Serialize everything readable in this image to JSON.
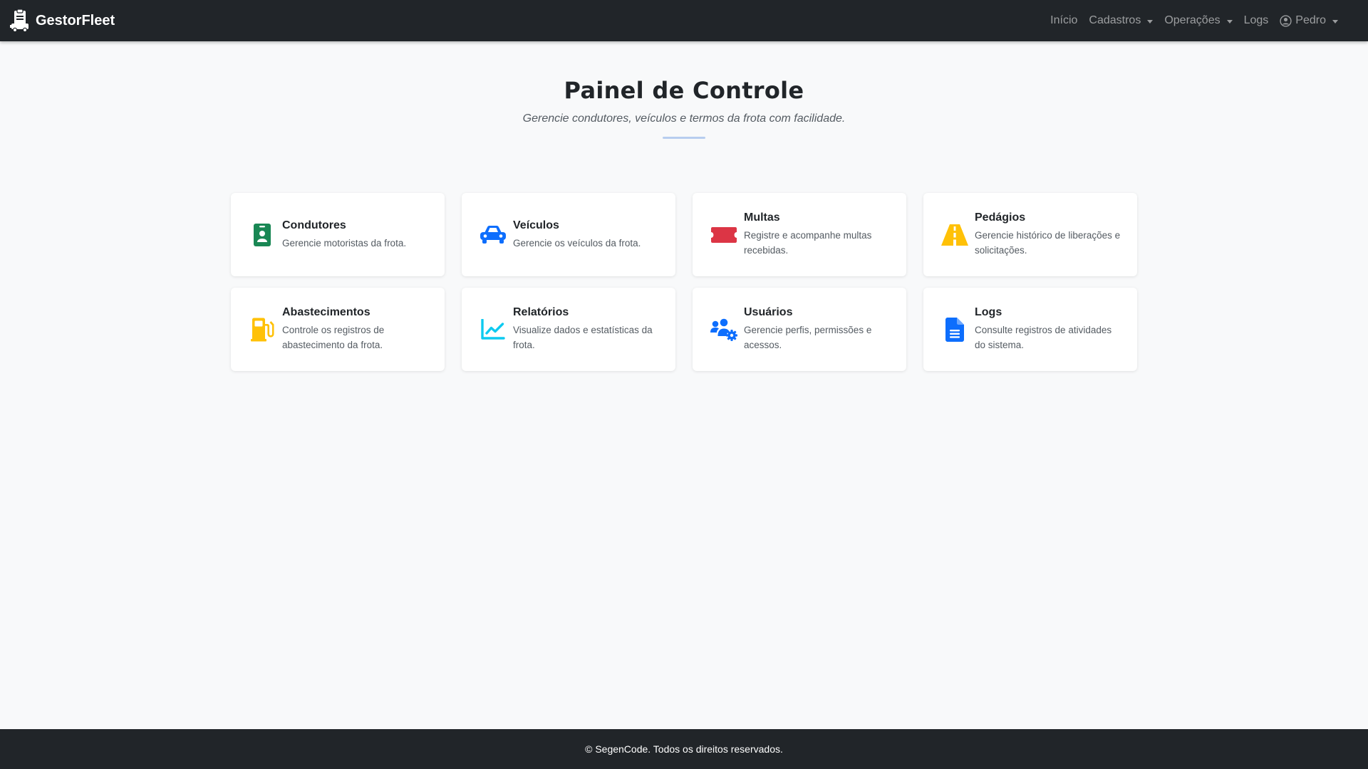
{
  "brand": {
    "name": "GestorFleet",
    "icon": "truck-clipboard-icon"
  },
  "nav": {
    "items": [
      {
        "label": "Início",
        "dropdown": false
      },
      {
        "label": "Cadastros",
        "dropdown": true
      },
      {
        "label": "Operações",
        "dropdown": true
      },
      {
        "label": "Logs",
        "dropdown": false
      }
    ],
    "user": {
      "label": "Pedro",
      "icon": "user-circle-icon"
    }
  },
  "header": {
    "title": "Painel de Controle",
    "subtitle": "Gerencie condutores, veículos e termos da frota com facilidade."
  },
  "cards": [
    {
      "title": "Condutores",
      "desc": "Gerencie motoristas da frota.",
      "icon": "id-badge-icon",
      "color": "#198754"
    },
    {
      "title": "Veículos",
      "desc": "Gerencie os veículos da frota.",
      "icon": "car-icon",
      "color": "#0d6efd"
    },
    {
      "title": "Multas",
      "desc": "Registre e acompanhe multas recebidas.",
      "icon": "ticket-icon",
      "color": "#dc3545"
    },
    {
      "title": "Pedágios",
      "desc": "Gerencie histórico de liberações e solicitações.",
      "icon": "road-icon",
      "color": "#ffc107"
    },
    {
      "title": "Abastecimentos",
      "desc": "Controle os registros de abastecimento da frota.",
      "icon": "gas-pump-icon",
      "color": "#ffc107"
    },
    {
      "title": "Relatórios",
      "desc": "Visualize dados e estatísticas da frota.",
      "icon": "chart-line-icon",
      "color": "#0dcaf0"
    },
    {
      "title": "Usuários",
      "desc": "Gerencie perfis, permissões e acessos.",
      "icon": "users-cog-icon",
      "color": "#0d6efd"
    },
    {
      "title": "Logs",
      "desc": "Consulte registros de atividades do sistema.",
      "icon": "file-lines-icon",
      "color": "#0d6efd"
    }
  ],
  "footer": {
    "text": "© SegenCode. Todos os direitos reservados."
  }
}
